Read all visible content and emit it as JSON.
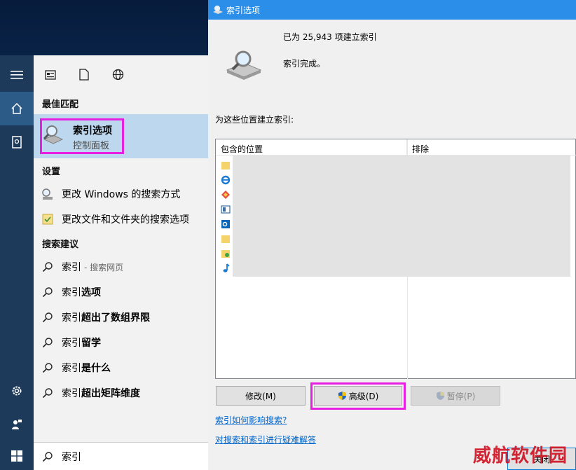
{
  "start_menu": {
    "best_match": {
      "title": "最佳匹配",
      "name": "索引选项",
      "subtitle": "控制面板"
    },
    "settings": {
      "title": "设置",
      "items": [
        {
          "label": "更改 Windows 的搜索方式"
        },
        {
          "label": "更改文件和文件夹的搜索选项"
        }
      ]
    },
    "suggestions": {
      "title": "搜索建议",
      "items": [
        {
          "prefix": "索引",
          "rest": "",
          "sub": "- 搜索网页"
        },
        {
          "prefix": "索引",
          "rest": "选项",
          "sub": ""
        },
        {
          "prefix": "索引",
          "rest": "超出了数组界限",
          "sub": ""
        },
        {
          "prefix": "索引",
          "rest": "留学",
          "sub": ""
        },
        {
          "prefix": "索引",
          "rest": "是什么",
          "sub": ""
        },
        {
          "prefix": "索引",
          "rest": "超出矩阵维度",
          "sub": ""
        }
      ]
    },
    "search_query": "索引"
  },
  "dialog": {
    "title": "索引选项",
    "status_count": "已为 25,943 项建立索引",
    "status_done": "索引完成。",
    "locations_label": "为这些位置建立索引:",
    "columns": {
      "included": "包含的位置",
      "excluded": "排除"
    },
    "buttons": {
      "modify": "修改(M)",
      "advanced": "高级(D)",
      "pause": "暂停(P)",
      "close": "关闭"
    },
    "links": {
      "how_affects": "索引如何影响搜索?",
      "troubleshoot": "对搜索和索引进行疑难解答"
    }
  },
  "watermark": "威航软件园",
  "colors": {
    "highlight": "#e81ee0",
    "title_bar": "#2b8ee8",
    "selection": "#bcd7ee",
    "rail": "#1e3a5a"
  }
}
